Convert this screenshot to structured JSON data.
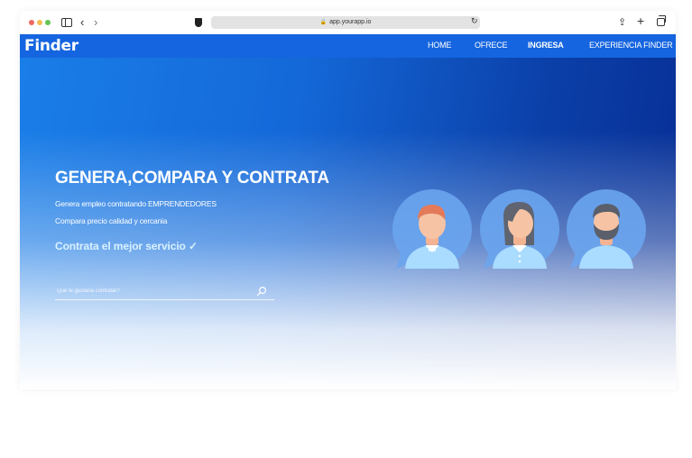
{
  "browser": {
    "url": "app.yourapp.io",
    "icons": [
      "window-dot-red",
      "window-dot-yellow",
      "window-dot-green",
      "sidebar-icon",
      "back-icon",
      "forward-icon",
      "shield-icon",
      "lock-icon",
      "reload-icon",
      "share-icon",
      "new-tab-icon",
      "tabs-overview-icon"
    ]
  },
  "nav": {
    "logo": "Finder",
    "links": [
      "HOME",
      "OFRECE",
      "INGRESA",
      "EXPERIENCIA FINDER"
    ],
    "active": "INGRESA"
  },
  "hero": {
    "title": "GENERA,COMPARA Y CONTRATA",
    "line1": "Genera empleo contratando EMPRENDEDORES",
    "line2": "Compara precio calidad y cercania",
    "cta": "Contrata el mejor servicio ✓",
    "search_placeholder": "Que te gustaria contratar?"
  },
  "colors": {
    "nav_bg": "#1565e0",
    "hero_gradient_start": "#1a7ee8",
    "hero_gradient_end": "#062d93",
    "avatar_circle": "#6aa5ee",
    "shirt": "#a9dcff",
    "cta_text": "#d8f1ff"
  }
}
